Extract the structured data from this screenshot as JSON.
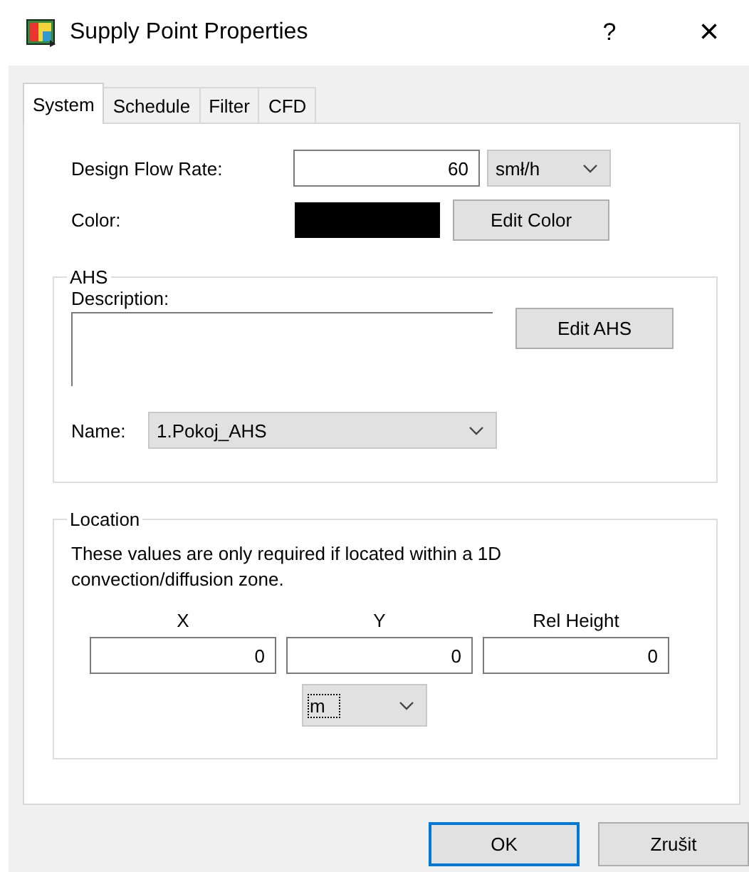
{
  "window": {
    "title": "Supply Point Properties",
    "help": "?",
    "close": "×"
  },
  "tabs": [
    {
      "label": "System",
      "selected": true
    },
    {
      "label": "Schedule",
      "selected": false
    },
    {
      "label": "Filter",
      "selected": false
    },
    {
      "label": "CFD",
      "selected": false
    }
  ],
  "design_flow_rate": {
    "label": "Design Flow Rate:",
    "value": "60",
    "unit": "smł/h"
  },
  "color": {
    "label": "Color:",
    "color": "#000000",
    "button": "Edit Color"
  },
  "ahs": {
    "legend": "AHS",
    "description_label": "Description:",
    "button": "Edit AHS",
    "name_label": "Name:",
    "name": "1.Pokoj_AHS"
  },
  "location": {
    "legend": "Location",
    "note": "These values are only required if located within a 1D convection/diffusion zone.",
    "fields": [
      {
        "label": "X",
        "value": "0"
      },
      {
        "label": "Y",
        "value": "0"
      },
      {
        "label": "Rel Height",
        "value": "0"
      }
    ],
    "unit": {
      "value": "m",
      "focused": true
    }
  },
  "buttons": [
    {
      "label": "OK",
      "focused": true
    },
    {
      "label": "Zrušit",
      "focused": false
    }
  ]
}
